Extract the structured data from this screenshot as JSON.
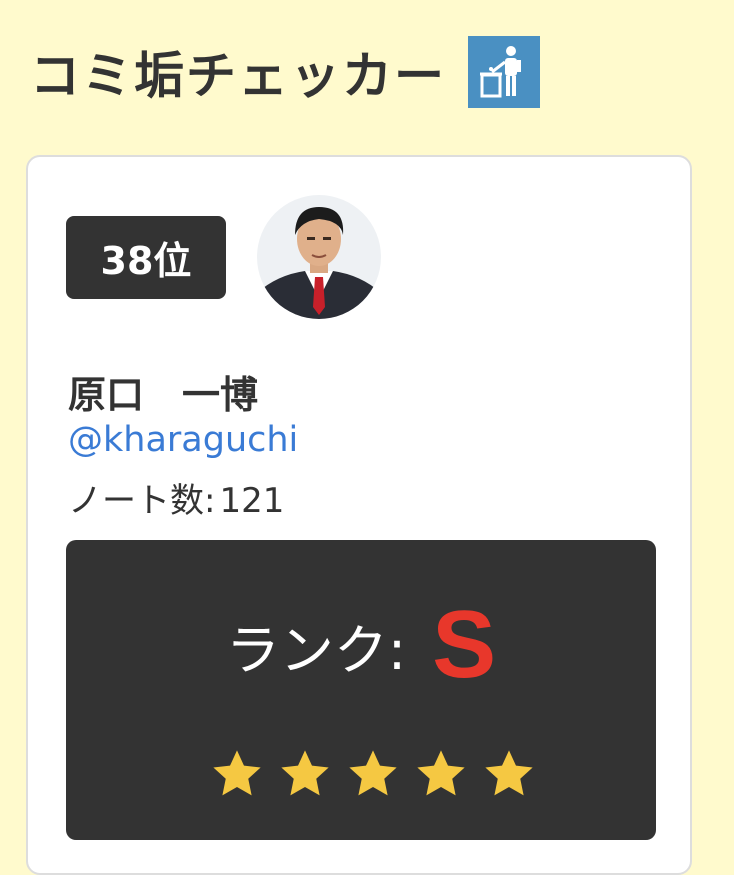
{
  "header": {
    "title": "コミ垢チェッカー",
    "icon": "trash-disposal-icon",
    "icon_bg": "#4a90c2"
  },
  "card": {
    "rank_badge": "38位",
    "avatar": "avatar-photo",
    "name": "原口　一博",
    "handle": "@kharaguchi",
    "notes_label": "ノート数:",
    "notes_count": "121",
    "rank_label": "ランク:",
    "rank_grade": "S",
    "rank_grade_color": "#e8372b",
    "stars_filled": 5,
    "stars_total": 5,
    "star_color": "#f5c842"
  }
}
